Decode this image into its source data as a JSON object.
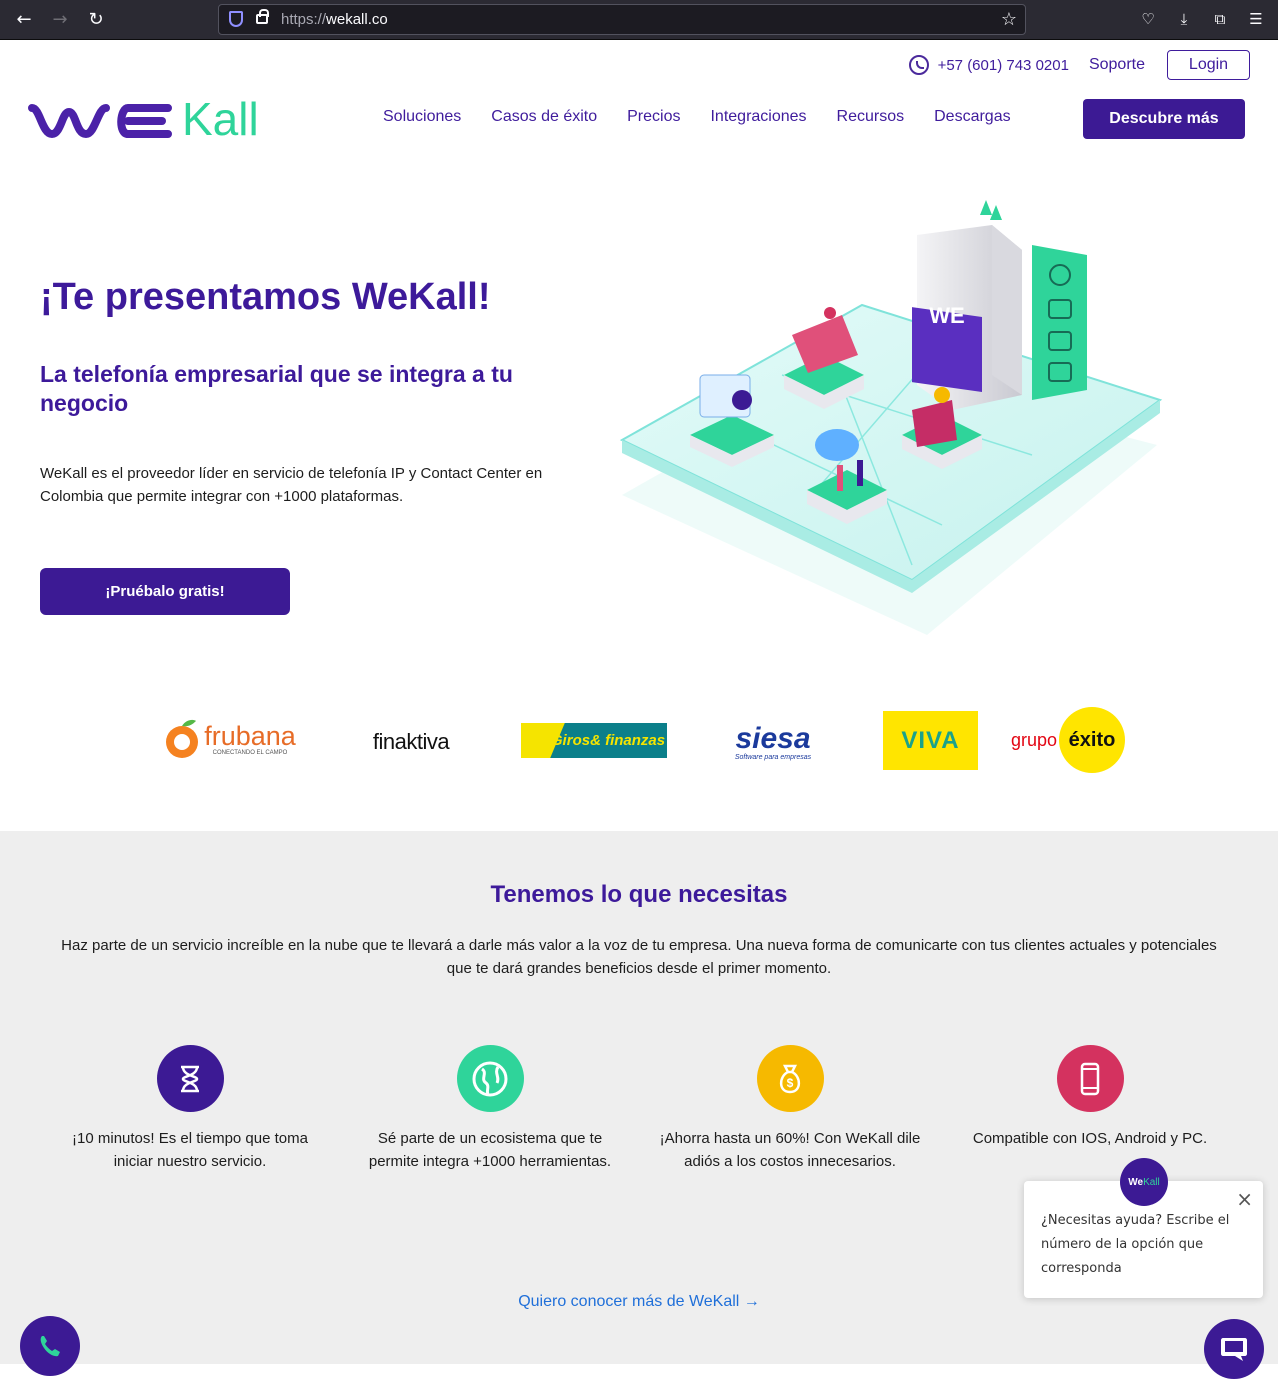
{
  "browser": {
    "url_protocol": "https://",
    "url_host": "wekall.co"
  },
  "topbar": {
    "phone": "+57 (601) 743 0201",
    "support_label": "Soporte",
    "login_label": "Login"
  },
  "logo": {
    "brand_left": "WE",
    "brand_right": "Kall"
  },
  "nav": {
    "items": [
      "Soluciones",
      "Casos de éxito",
      "Precios",
      "Integraciones",
      "Recursos",
      "Descargas"
    ],
    "cta_label": "Descubre más"
  },
  "hero": {
    "title": "¡Te presentamos WeKall!",
    "subtitle": "La telefonía empresarial que se integra a tu negocio",
    "description": "WeKall es el proveedor líder en servicio de telefonía IP y Contact Center en Colombia que permite integrar con +1000 plataformas.",
    "cta_label": "¡Pruébalo gratis!"
  },
  "clients": [
    {
      "name": "frubana",
      "tagline": "CONECTANDO EL CAMPO"
    },
    {
      "name": "finaktiva"
    },
    {
      "name": "Giros& finanzas"
    },
    {
      "name": "siesa",
      "tagline": "Software para empresas"
    },
    {
      "name": "VIVA"
    },
    {
      "name": "grupo éxito",
      "prefix": "grupo",
      "main": "éxito"
    }
  ],
  "features": {
    "title": "Tenemos lo que necesitas",
    "description": "Haz parte de un servicio increíble en la nube que te llevará a darle más valor a la voz de tu empresa. Una nueva forma de comunicarte con tus clientes actuales y potenciales que te dará grandes beneficios desde el primer momento.",
    "items": [
      {
        "icon": "hourglass-icon",
        "color": "#3c1a94",
        "text": "¡10 minutos! Es el tiempo que toma iniciar nuestro servicio."
      },
      {
        "icon": "globe-icon",
        "color": "#2fd49a",
        "text": "Sé parte de un ecosistema que te permite integra +1000 herramientas."
      },
      {
        "icon": "money-bag-icon",
        "color": "#f6b900",
        "text": "¡Ahorra hasta un 60%! Con WeKall dile adiós a los costos innecesarios."
      },
      {
        "icon": "mobile-phone-icon",
        "color": "#d4325f",
        "text": "Compatible con IOS, Android y PC."
      }
    ],
    "more_link": "Quiero conocer más de WeKall →"
  },
  "chat": {
    "avatar_left": "We",
    "avatar_right": "Kall",
    "message": "¿Necesitas ayuda? Escribe el número de la opción que corresponda",
    "close": "×"
  },
  "colors": {
    "primary": "#3c1a94",
    "accent": "#2fd49a",
    "link": "#1f6fd9"
  }
}
